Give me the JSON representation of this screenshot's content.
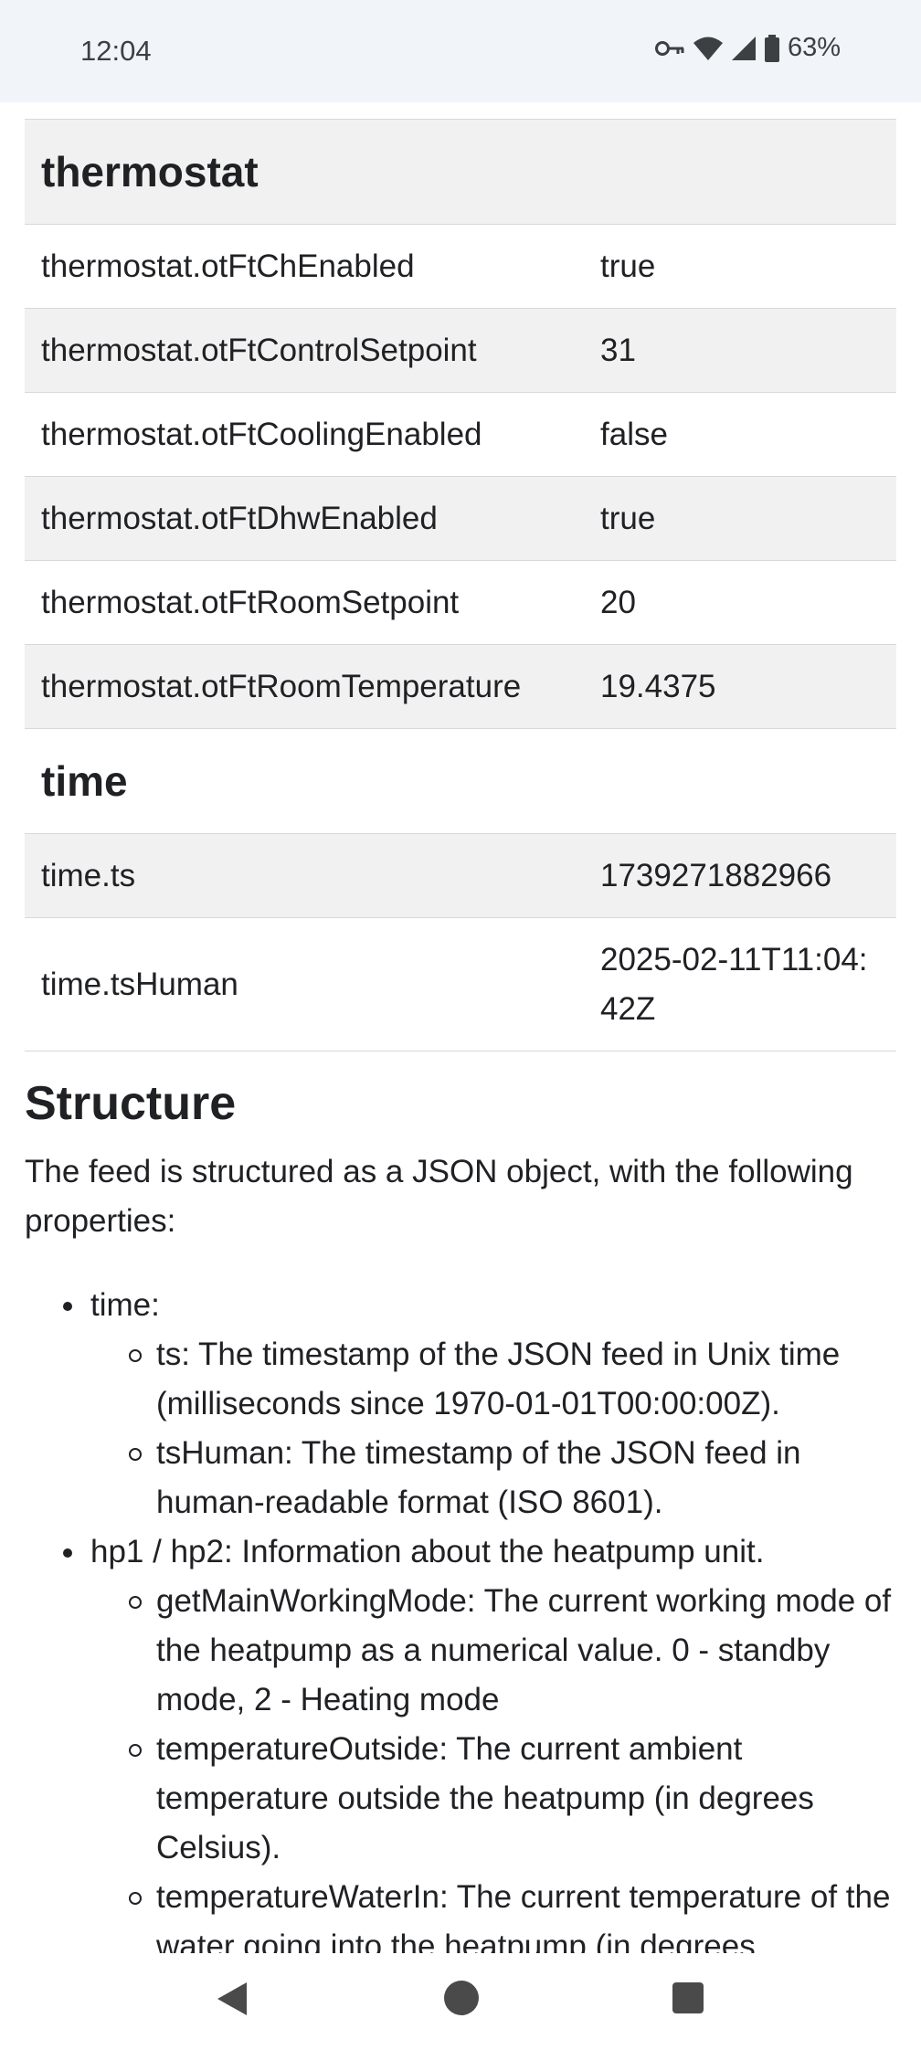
{
  "status_bar": {
    "time": "12:04",
    "battery_percent": "63%",
    "icons": [
      "key-icon",
      "wifi-icon",
      "signal-icon",
      "battery-icon"
    ]
  },
  "table": {
    "sections": [
      {
        "title": "thermostat",
        "rows": [
          {
            "key": "thermostat.otFtChEnabled",
            "value": "true"
          },
          {
            "key": "thermostat.otFtControlSetpoint",
            "value": "31"
          },
          {
            "key": "thermostat.otFtCoolingEnabled",
            "value": "false"
          },
          {
            "key": "thermostat.otFtDhwEnabled",
            "value": "true"
          },
          {
            "key": "thermostat.otFtRoomSetpoint",
            "value": "20"
          },
          {
            "key": "thermostat.otFtRoomTemperature",
            "value": "19.4375"
          }
        ]
      },
      {
        "title": "time",
        "rows": [
          {
            "key": "time.ts",
            "value": "1739271882966"
          },
          {
            "key": "time.tsHuman",
            "value": "2025-02-11T11:04:42Z"
          }
        ]
      }
    ]
  },
  "structure": {
    "heading": "Structure",
    "intro": "The feed is structured as a JSON object, with the following properties:",
    "items": [
      {
        "label": "time:",
        "children": [
          "ts: The timestamp of the JSON feed in Unix time (milliseconds since 1970-01-01T00:00:00Z).",
          "tsHuman: The timestamp of the JSON feed in human-readable format (ISO 8601)."
        ]
      },
      {
        "label": "hp1 / hp2: Information about the heatpump unit.",
        "children": [
          "getMainWorkingMode: The current working mode of the heatpump as a numerical value. 0 - standby mode, 2 - Heating mode",
          "temperatureOutside: The current ambient temperature outside the heatpump (in degrees Celsius).",
          "temperatureWaterIn: The current temperature of the water going into the heatpump (in degrees"
        ]
      }
    ]
  },
  "nav_bar": {
    "buttons": [
      "back-icon",
      "home-icon",
      "recents-icon"
    ]
  }
}
